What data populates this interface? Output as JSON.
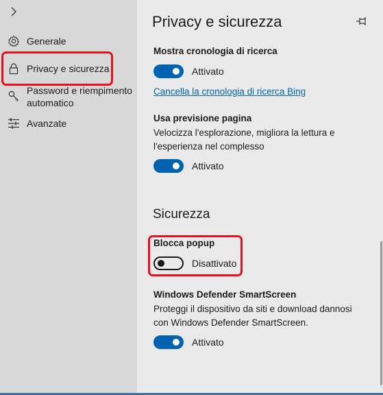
{
  "sidebar": {
    "items": [
      {
        "label": "Generale",
        "icon": "gear-icon"
      },
      {
        "label": "Privacy e sicurezza",
        "icon": "lock-icon",
        "selected": true
      },
      {
        "label": "Password e riempimento automatico",
        "icon": "key-icon"
      },
      {
        "label": "Avanzate",
        "icon": "sliders-icon"
      }
    ]
  },
  "main": {
    "title": "Privacy e sicurezza",
    "search_history": {
      "title": "Mostra cronologia di ricerca",
      "state": "Attivato",
      "enabled": true,
      "clear_link": "Cancella la cronologia di ricerca Bing"
    },
    "page_prediction": {
      "title": "Usa previsione pagina",
      "description": "Velocizza l'esplorazione, migliora la lettura e l'esperienza nel complesso",
      "state": "Attivato",
      "enabled": true
    },
    "security_section": {
      "title": "Sicurezza"
    },
    "block_popups": {
      "title": "Blocca popup",
      "state": "Disattivato",
      "enabled": false
    },
    "smartscreen": {
      "title": "Windows Defender SmartScreen",
      "description": "Proteggi il dispositivo da siti e download dannosi con Windows Defender SmartScreen.",
      "state": "Attivato",
      "enabled": true
    }
  },
  "colors": {
    "accent": "#0063b1",
    "highlight": "#e8101b",
    "sidebar_bg": "#d8d8d8",
    "content_bg": "#eaeaea"
  }
}
